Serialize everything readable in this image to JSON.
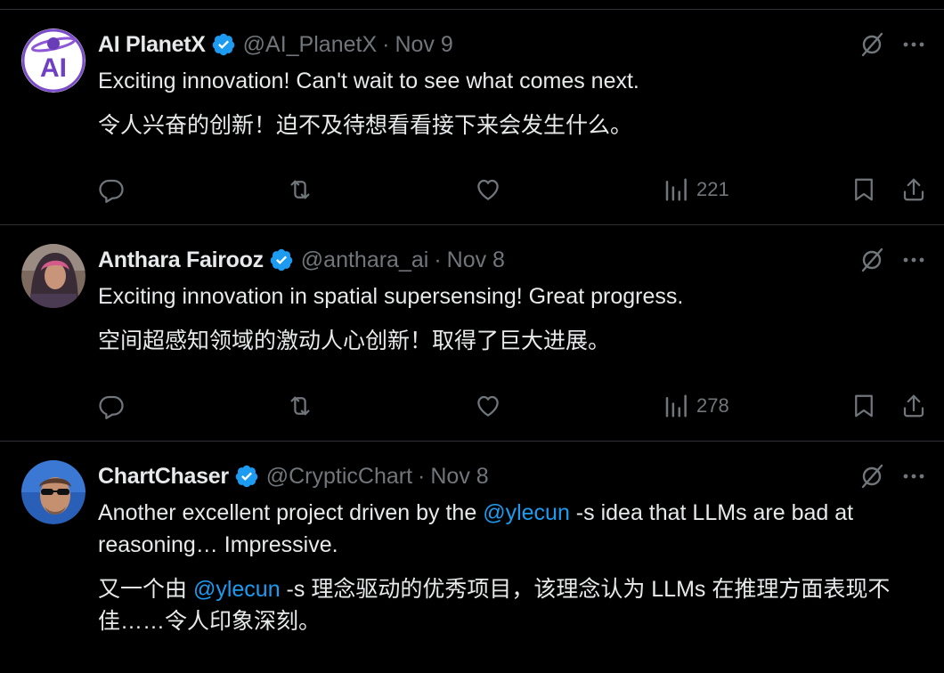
{
  "colors": {
    "background": "#000000",
    "text": "#e7e9ea",
    "secondary": "#71767b",
    "divider": "#2f3336",
    "accent": "#1d9bf0"
  },
  "tweets": [
    {
      "name": "AI PlanetX",
      "handle": "@AI_PlanetX",
      "separator": "·",
      "date": "Nov 9",
      "verified": true,
      "text_en": "Exciting innovation! Can't wait to see what comes next.",
      "text_zh": "令人兴奋的创新！迫不及待想看看接下来会发生什么。",
      "views": "221",
      "avatar_letters": "AI"
    },
    {
      "name": "Anthara Fairooz",
      "handle": "@anthara_ai",
      "separator": "·",
      "date": "Nov 8",
      "verified": true,
      "text_en": "Exciting innovation in spatial supersensing! Great progress.",
      "text_zh": "空间超感知领域的激动人心创新！取得了巨大进展。",
      "views": "278"
    },
    {
      "name": "ChartChaser",
      "handle": "@CrypticChart",
      "separator": "·",
      "date": "Nov 8",
      "verified": true,
      "text_en_parts": {
        "before": "Another excellent project driven by the ",
        "mention": "@ylecun",
        "after": " -s idea that LLMs are bad at reasoning… Impressive."
      },
      "text_zh_parts": {
        "before": "又一个由 ",
        "mention": "@ylecun",
        "after": " -s 理念驱动的优秀项目，该理念认为 LLMs 在推理方面表现不佳……令人印象深刻。"
      }
    }
  ],
  "icons": {
    "verified": "verified-badge-icon",
    "grok": "grok-icon",
    "more": "more-icon",
    "reply": "reply-icon",
    "retweet": "retweet-icon",
    "like": "like-icon",
    "views": "views-icon",
    "bookmark": "bookmark-icon",
    "share": "share-icon"
  }
}
